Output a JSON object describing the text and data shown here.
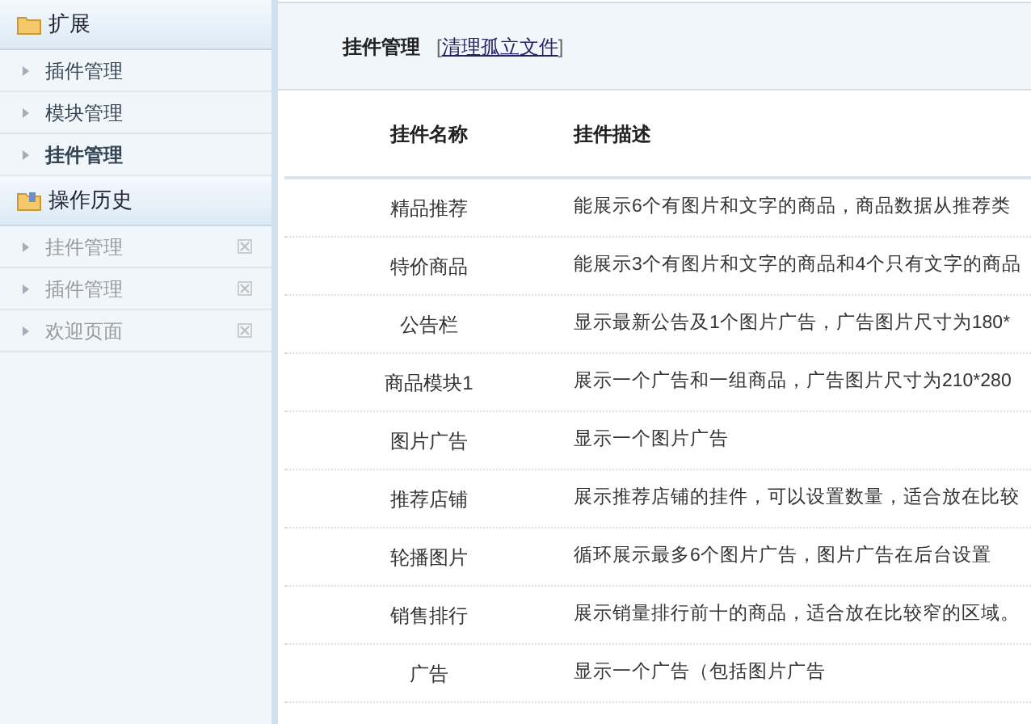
{
  "sidebar": {
    "sections": [
      {
        "title": "扩展",
        "kind": "menu",
        "items": [
          {
            "label": "插件管理",
            "selected": false
          },
          {
            "label": "模块管理",
            "selected": false
          },
          {
            "label": "挂件管理",
            "selected": true
          }
        ]
      },
      {
        "title": "操作历史",
        "kind": "history",
        "items": [
          {
            "label": "挂件管理",
            "selected": false
          },
          {
            "label": "插件管理",
            "selected": false
          },
          {
            "label": "欢迎页面",
            "selected": false
          }
        ]
      }
    ]
  },
  "page": {
    "title": "挂件管理",
    "link_open": "[",
    "link": "清理孤立文件",
    "link_close": "]"
  },
  "table": {
    "columns": [
      "挂件名称",
      "挂件描述"
    ],
    "rows": [
      [
        "精品推荐",
        "能展示6个有图片和文字的商品，商品数据从推荐类"
      ],
      [
        "特价商品",
        "能展示3个有图片和文字的商品和4个只有文字的商品"
      ],
      [
        "公告栏",
        "显示最新公告及1个图片广告，广告图片尺寸为180*"
      ],
      [
        "商品模块1",
        "展示一个广告和一组商品，广告图片尺寸为210*280"
      ],
      [
        "图片广告",
        "显示一个图片广告"
      ],
      [
        "推荐店铺",
        "展示推荐店铺的挂件，可以设置数量，适合放在比较"
      ],
      [
        "轮播图片",
        "循环展示最多6个图片广告，图片广告在后台设置"
      ],
      [
        "销售排行",
        "展示销量排行前十的商品，适合放在比较窄的区域。"
      ],
      [
        "广告",
        "显示一个广告（包括图片广告"
      ]
    ]
  }
}
